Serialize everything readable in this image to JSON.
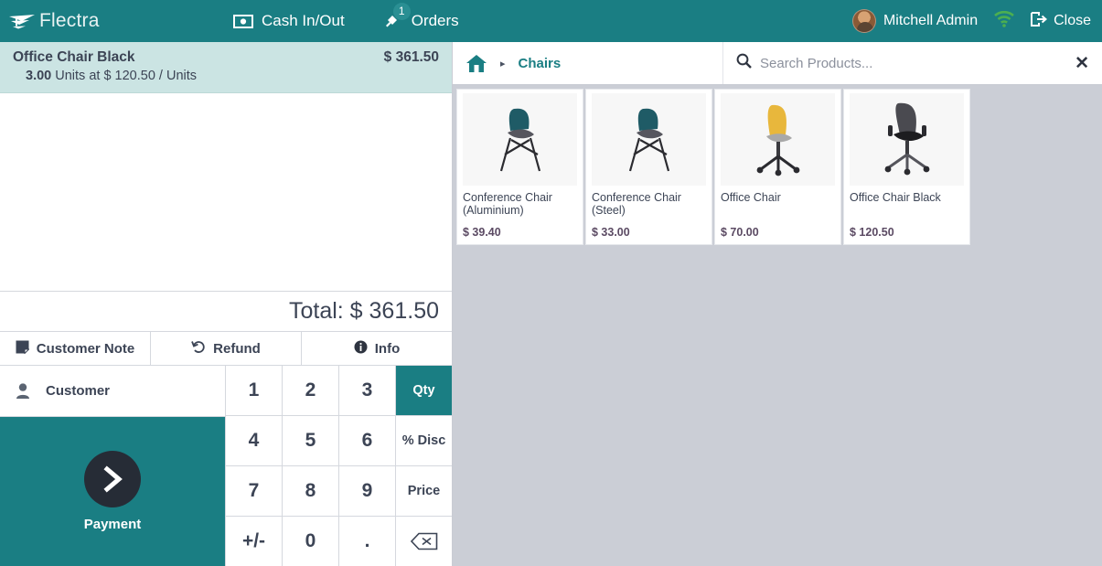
{
  "app": {
    "brand": "Flectra",
    "accent_teal": "#1a7e83",
    "selection_teal": "#cbe4e3",
    "panel_gray": "#cbced6",
    "dark": "#262c36"
  },
  "topbar": {
    "cash_in_out_label": "Cash In/Out",
    "cash_icon": "cash-banknote-icon",
    "orders_label": "Orders",
    "orders_icon": "orders-diamond-icon",
    "orders_badge": "1",
    "user_name": "Mitchell Admin",
    "avatar_icon": "avatar",
    "wifi_icon": "wifi-icon",
    "wifi_color": "#4caf50",
    "close_label": "Close",
    "close_icon": "logout-icon"
  },
  "order": {
    "lines": [
      {
        "name": "Office Chair Black",
        "price": "$ 361.50",
        "qty": "3.00",
        "detail": " Units at $ 120.50 / Units"
      }
    ],
    "total_label": "Total: $ 361.50"
  },
  "tabs": [
    {
      "label": "Customer Note",
      "icon": "note-icon"
    },
    {
      "label": "Refund",
      "icon": "refund-undo-icon"
    },
    {
      "label": "Info",
      "icon": "info-circle-icon"
    }
  ],
  "actions": {
    "customer_label": "Customer",
    "customer_icon": "person-icon",
    "payment_label": "Payment",
    "payment_icon": "chevron-right-icon"
  },
  "numpad": {
    "keys": [
      {
        "label": "1",
        "type": "digit",
        "active": false
      },
      {
        "label": "2",
        "type": "digit",
        "active": false
      },
      {
        "label": "3",
        "type": "digit",
        "active": false
      },
      {
        "label": "Qty",
        "type": "mode",
        "active": true
      },
      {
        "label": "4",
        "type": "digit",
        "active": false
      },
      {
        "label": "5",
        "type": "digit",
        "active": false
      },
      {
        "label": "6",
        "type": "digit",
        "active": false
      },
      {
        "label": "% Disc",
        "type": "mode",
        "active": false
      },
      {
        "label": "7",
        "type": "digit",
        "active": false
      },
      {
        "label": "8",
        "type": "digit",
        "active": false
      },
      {
        "label": "9",
        "type": "digit",
        "active": false
      },
      {
        "label": "Price",
        "type": "mode",
        "active": false
      },
      {
        "label": "+/-",
        "type": "digit",
        "active": false
      },
      {
        "label": "0",
        "type": "digit",
        "active": false
      },
      {
        "label": ".",
        "type": "digit",
        "active": false
      },
      {
        "label": "",
        "type": "backspace",
        "active": false
      }
    ]
  },
  "breadcrumb": {
    "home_icon": "home-icon",
    "separator": "▸",
    "current": "Chairs"
  },
  "search": {
    "icon": "search-icon",
    "placeholder": "Search Products...",
    "value": "",
    "clear_icon": "close-x-icon"
  },
  "products": [
    {
      "name": "Conference Chair (Aluminium)",
      "price": "$ 39.40",
      "image": "conference-chair-teal"
    },
    {
      "name": "Conference Chair (Steel)",
      "price": "$ 33.00",
      "image": "conference-chair-teal"
    },
    {
      "name": "Office Chair",
      "price": "$ 70.00",
      "image": "office-chair-yellow"
    },
    {
      "name": "Office Chair Black",
      "price": "$ 120.50",
      "image": "office-chair-black"
    }
  ]
}
